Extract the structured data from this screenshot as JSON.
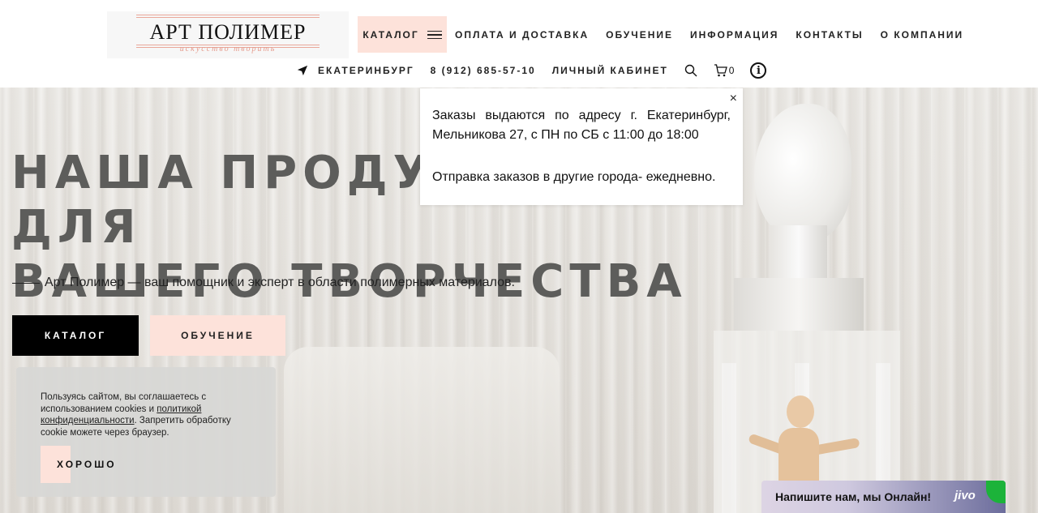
{
  "logo": {
    "title": "АРТ ПОЛИМЕР",
    "tagline": "искусство творить"
  },
  "nav": {
    "catalog": "КАТАЛОГ",
    "items": [
      "ОПЛАТА И ДОСТАВКА",
      "ОБУЧЕНИЕ",
      "ИНФОРМАЦИЯ",
      "КОНТАКТЫ",
      "О КОМПАНИИ"
    ],
    "city": "ЕКАТЕРИНБУРГ",
    "phone": "8 (912) 685-57-10",
    "account": "ЛИЧНЫЙ КАБИНЕТ",
    "cart_count": "0",
    "info": "i"
  },
  "popup": {
    "line1": "Заказы выдаются по адресу г. Екатеринбург, Мельникова 27, с ПН по СБ с 11:00 до 18:00",
    "line2": "Отправка заказов в другие города- ежедневно.",
    "close": "×"
  },
  "hero": {
    "title": "НАША ПРОДУКЦИЯ ДЛЯ\nВАШЕГО ТВОРЧЕСТВА",
    "subtitle": "Арт Полимер — ваш помощник и эксперт в области полимерных материалов.",
    "btn_catalog": "КАТАЛОГ",
    "btn_study": "ОБУЧЕНИЕ"
  },
  "cookie": {
    "text_before": "Пользуясь сайтом, вы соглашаетесь с использованием cookies и ",
    "link": "политикой конфиденциальности",
    "text_after": ". Запретить обработку cookie можете через браузер.",
    "ok": "ХОРОШО"
  },
  "chat": {
    "label": "Напишите нам, мы Онлайн!",
    "brand": "jivo"
  },
  "colors": {
    "accent_pink": "#fde2da",
    "logo_rule": "#e9a79a",
    "chat_green": "#1cb33a"
  }
}
